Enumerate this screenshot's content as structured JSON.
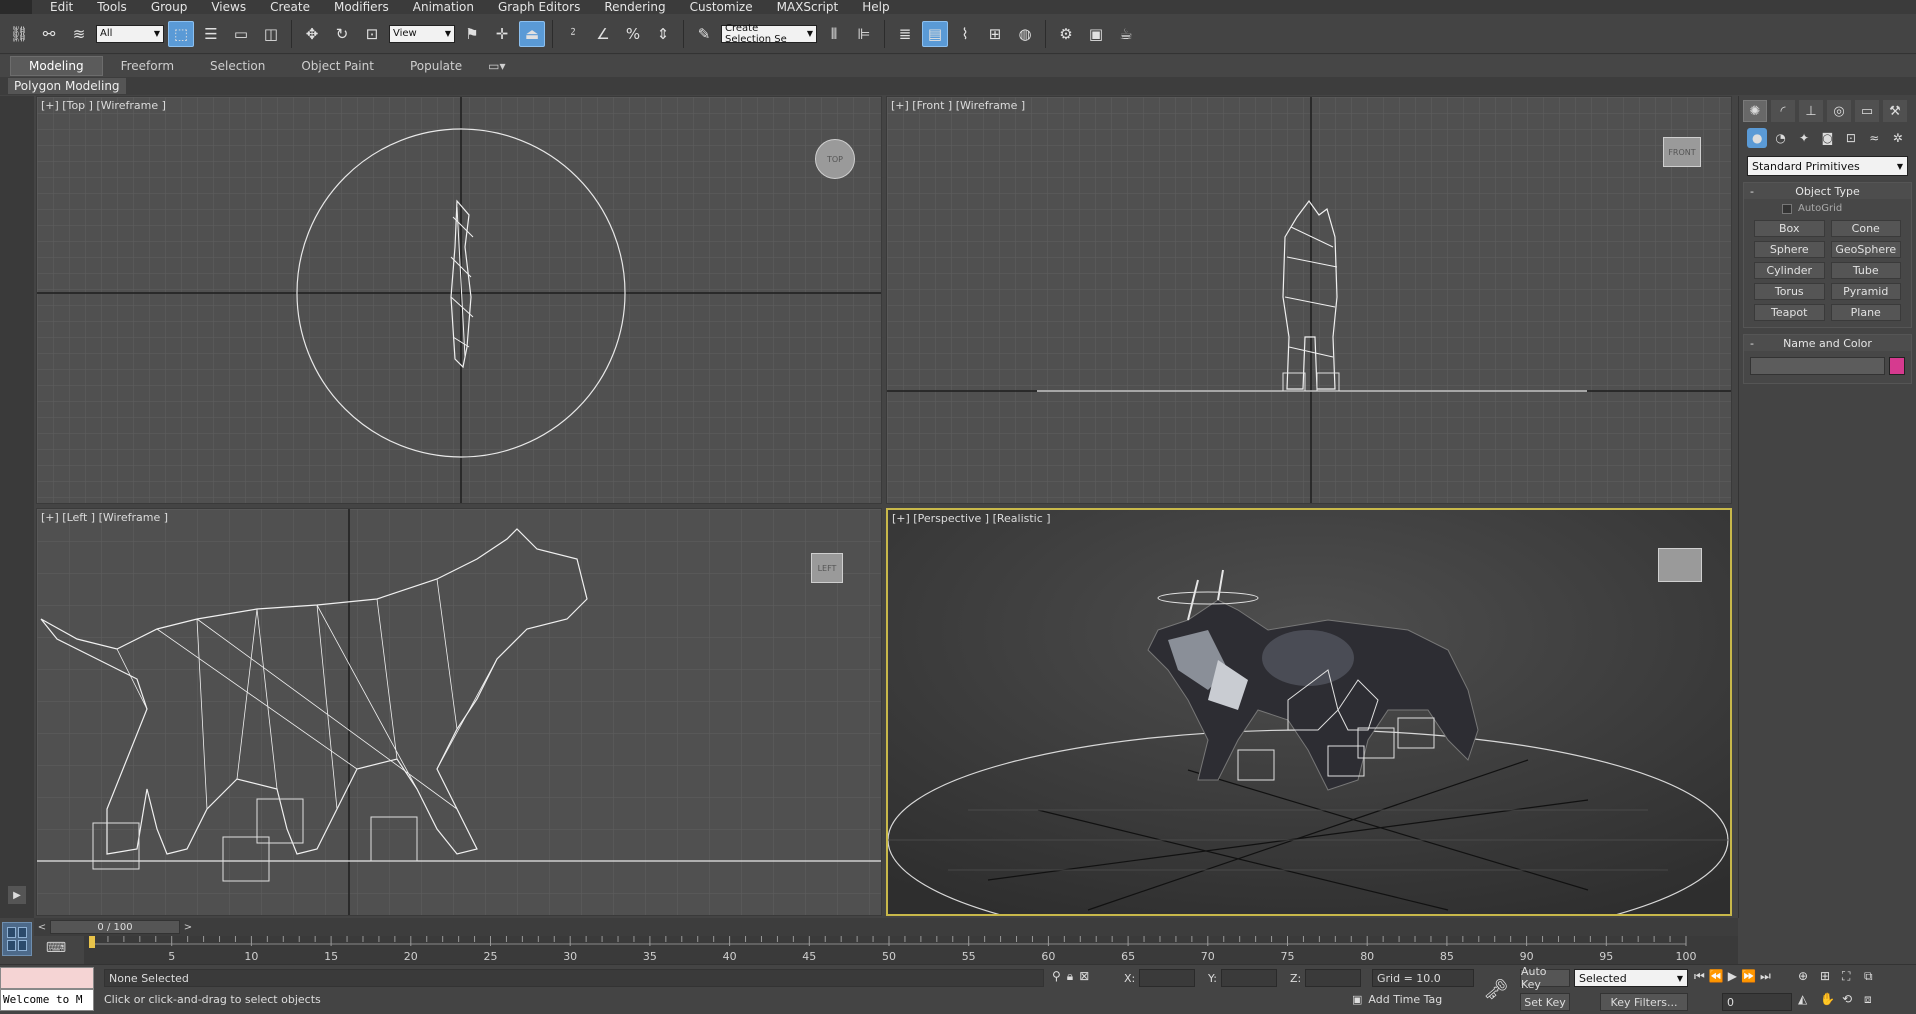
{
  "menu": {
    "items": [
      "Edit",
      "Tools",
      "Group",
      "Views",
      "Create",
      "Modifiers",
      "Animation",
      "Graph Editors",
      "Rendering",
      "Customize",
      "MAXScript",
      "Help"
    ]
  },
  "toolbar": {
    "filter_value": "All",
    "ref_coord_value": "View",
    "named_selection_placeholder": "Create Selection Se"
  },
  "ribbon": {
    "tabs": [
      "Modeling",
      "Freeform",
      "Selection",
      "Object Paint",
      "Populate"
    ],
    "active_tab": "Modeling",
    "sub_label": "Polygon Modeling"
  },
  "viewports": {
    "top": {
      "label": "[+] [Top ] [Wireframe ]",
      "cube": "TOP"
    },
    "front": {
      "label": "[+] [Front ] [Wireframe ]",
      "cube": "FRONT"
    },
    "left": {
      "label": "[+] [Left ] [Wireframe ]",
      "cube": "LEFT"
    },
    "perspective": {
      "label": "[+] [Perspective ] [Realistic ]"
    }
  },
  "command_panel": {
    "dropdown": "Standard Primitives",
    "object_type_title": "Object Type",
    "autogrid_label": "AutoGrid",
    "object_types": [
      "Box",
      "Cone",
      "Sphere",
      "GeoSphere",
      "Cylinder",
      "Tube",
      "Torus",
      "Pyramid",
      "Teapot",
      "Plane"
    ],
    "name_color_title": "Name and Color",
    "object_color": "#d63a8f"
  },
  "timeline": {
    "frame_display": "0 / 100",
    "ticks": [
      5,
      10,
      15,
      20,
      25,
      30,
      35,
      40,
      45,
      50,
      55,
      60,
      65,
      70,
      75,
      80,
      85,
      90,
      95,
      100
    ]
  },
  "status": {
    "maxscript_text": "Welcome to M",
    "selection_status": "None Selected",
    "prompt": "Click or click-and-drag to select objects",
    "x_label": "X:",
    "y_label": "Y:",
    "z_label": "Z:",
    "grid": "Grid = 10.0",
    "add_time_tag": "Add Time Tag",
    "auto_key": "Auto Key",
    "set_key": "Set Key",
    "selected_dropdown": "Selected",
    "key_filters": "Key Filters...",
    "frame_value": "0"
  }
}
